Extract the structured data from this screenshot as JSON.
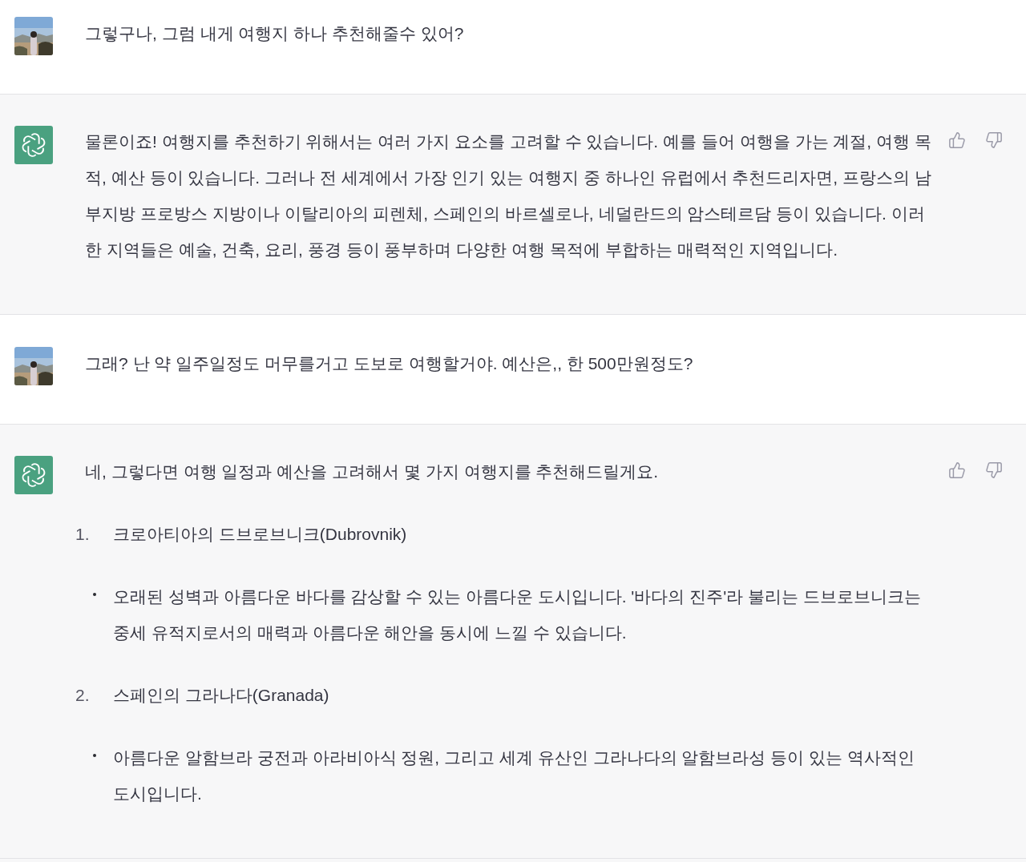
{
  "messages": [
    {
      "kind": "user",
      "text": "그렇구나, 그럼 내게 여행지 하나 추천해줄수 있어?"
    },
    {
      "kind": "assistant",
      "paragraphs": [
        "물론이죠! 여행지를 추천하기 위해서는 여러 가지 요소를 고려할 수 있습니다. 예를 들어 여행을 가는 계절, 여행 목적, 예산 등이 있습니다. 그러나 전 세계에서 가장 인기 있는 여행지 중 하나인 유럽에서 추천드리자면, 프랑스의 남부지방 프로방스 지방이나 이탈리아의 피렌체, 스페인의 바르셀로나, 네덜란드의 암스테르담 등이 있습니다. 이러한 지역들은 예술, 건축, 요리, 풍경 등이 풍부하며 다양한 여행 목적에 부합하는 매력적인 지역입니다."
      ]
    },
    {
      "kind": "user",
      "text": "그래? 난 약 일주일정도 머무를거고 도보로 여행할거야. 예산은,, 한 500만원정도?"
    },
    {
      "kind": "assistant",
      "paragraphs": [
        "네, 그렇다면 여행 일정과 예산을 고려해서 몇 가지 여행지를 추천해드릴게요."
      ],
      "list": [
        {
          "number": "1.",
          "title": "크로아티아의 드브로브니크(Dubrovnik)",
          "bullets": [
            "오래된 성벽과 아름다운 바다를 감상할 수 있는 아름다운 도시입니다. '바다의 진주'라 불리는 드브로브니크는 중세 유적지로서의 매력과 아름다운 해안을 동시에 느낄 수 있습니다."
          ]
        },
        {
          "number": "2.",
          "title": "스페인의 그라나다(Granada)",
          "bullets": [
            "아름다운 알함브라 궁전과 아라비아식 정원, 그리고 세계 유산인 그라나다의 알함브라성 등이 있는 역사적인 도시입니다."
          ]
        }
      ]
    }
  ]
}
